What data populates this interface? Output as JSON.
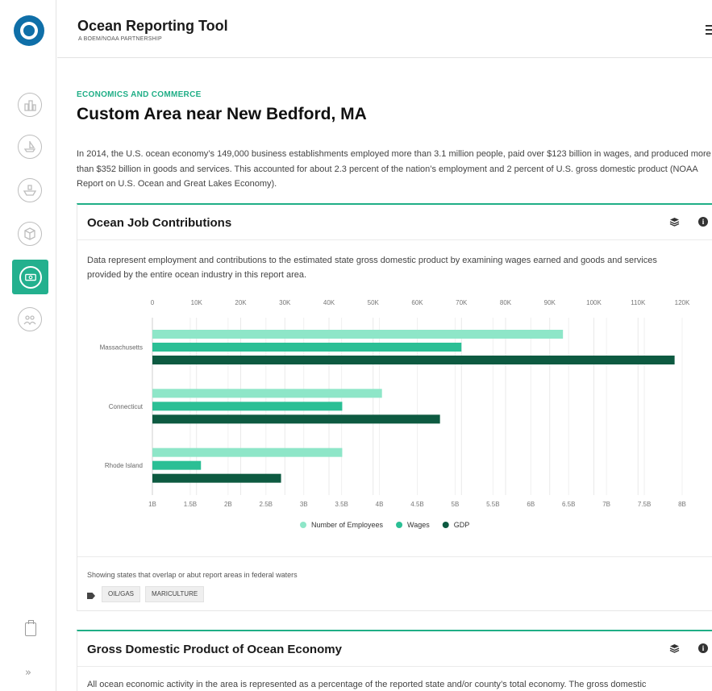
{
  "app": {
    "title": "Ocean Reporting Tool",
    "subtitle": "A BOEM/NOAA PARTNERSHIP"
  },
  "sidebar": {
    "items": [
      {
        "icon": "buildings-icon",
        "active": false
      },
      {
        "icon": "boat-icon",
        "active": false
      },
      {
        "icon": "ship-icon",
        "active": false
      },
      {
        "icon": "cube-icon",
        "active": false
      },
      {
        "icon": "money-icon",
        "active": true
      },
      {
        "icon": "people-icon",
        "active": false
      }
    ],
    "expand_label": "»"
  },
  "page": {
    "category": "ECONOMICS AND COMMERCE",
    "title": "Custom Area near New Bedford, MA",
    "intro": "In 2014, the U.S. ocean economy’s 149,000 business establishments employed more than 3.1 million people, paid over $123 billion in wages, and produced more than $352 billion in goods and services. This accounted for about 2.3 percent of the nation’s employment and 2 percent of U.S. gross domestic product (NOAA Report on U.S. Ocean and Great Lakes Economy)."
  },
  "card1": {
    "title": "Ocean Job Contributions",
    "description": "Data represent employment and contributions to the estimated state gross domestic product by examining wages earned and goods and services provided by the entire ocean industry in this report area.",
    "footnote": "Showing states that overlap or abut report areas in federal waters",
    "tags": [
      "OIL/GAS",
      "MARICULTURE"
    ]
  },
  "card2": {
    "title": "Gross Domestic Product of Ocean Economy",
    "description": "All ocean economic activity in the area is represented as a percentage of the reported state and/or county’s total economy. The gross domestic"
  },
  "colors": {
    "accent": "#1fae86",
    "employees": "#8ee6c8",
    "wages": "#2bbf95",
    "gdp": "#0d5a41"
  },
  "chart_data": {
    "type": "bar",
    "orientation": "horizontal",
    "categories": [
      "Massachusetts",
      "Connecticut",
      "Rhode Island"
    ],
    "top_axis": {
      "ticks": [
        "0",
        "10K",
        "20K",
        "30K",
        "40K",
        "50K",
        "60K",
        "70K",
        "80K",
        "90K",
        "100K",
        "110K",
        "120K"
      ],
      "range": [
        0,
        120000
      ]
    },
    "bottom_axis": {
      "ticks": [
        "1B",
        "1.5B",
        "2B",
        "2.5B",
        "3B",
        "3.5B",
        "4B",
        "4.5B",
        "5B",
        "5.5B",
        "6B",
        "6.5B",
        "7B",
        "7.5B",
        "8B"
      ],
      "range": [
        1000000000,
        8000000000
      ]
    },
    "series": [
      {
        "name": "Number of Employees",
        "axis": "top",
        "values": [
          93000,
          52000,
          43000
        ]
      },
      {
        "name": "Wages",
        "axis": "top",
        "values": [
          70000,
          43000,
          11000
        ]
      },
      {
        "name": "GDP",
        "axis": "bottom",
        "values": [
          7900000000,
          4800000000,
          2700000000
        ]
      }
    ],
    "legend_position": "bottom",
    "grid": true
  }
}
